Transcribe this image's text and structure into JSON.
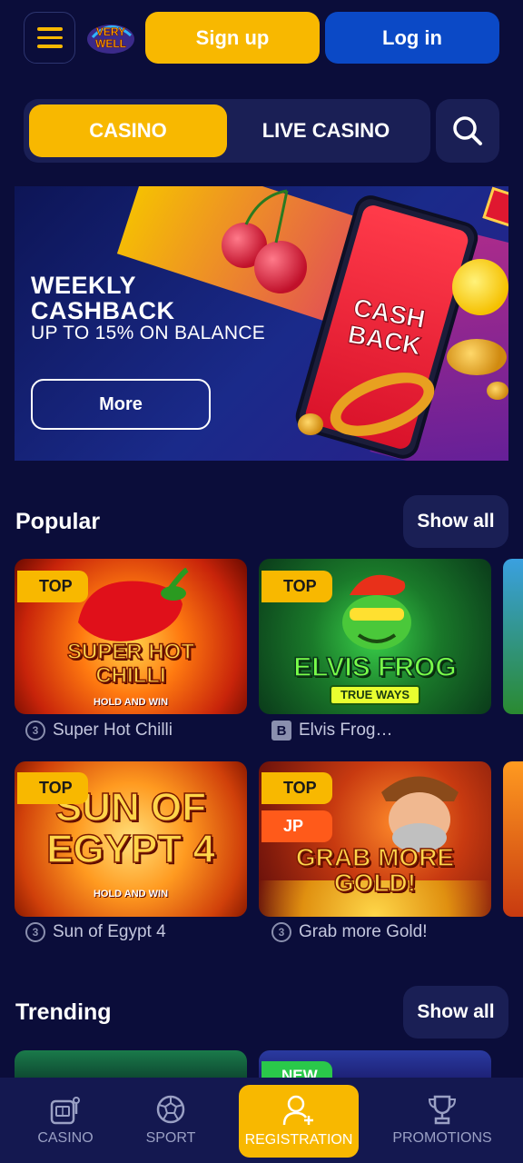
{
  "header": {
    "menu_icon": "hamburger-icon",
    "logo_text": "VERY WELL",
    "signup_label": "Sign up",
    "login_label": "Log in"
  },
  "tabs": [
    {
      "label": "CASINO",
      "active": true
    },
    {
      "label": "LIVE CASINO",
      "active": false
    }
  ],
  "search_icon": "search-icon",
  "banner": {
    "title": "WEEKLY CASHBACK",
    "subtitle": "UP TO 15% ON BALANCE",
    "button_label": "More",
    "phone_text": "CASH BACK"
  },
  "popular": {
    "title": "Popular",
    "show_all_label": "Show all",
    "games": [
      {
        "name": "Super Hot Chilli",
        "art_title": "SUPER HOT CHILLI",
        "art_sub": "HOLD AND WIN",
        "badges": [
          "TOP"
        ],
        "provider_icon": "3"
      },
      {
        "name": "Elvis Frog…",
        "art_title": "ELVIS FROG",
        "art_sub": "TRUE WAYS",
        "badges": [
          "TOP"
        ],
        "provider_icon": "B"
      },
      {
        "name": "Sun of Egypt 4",
        "art_title": "SUN OF EGYPT 4",
        "art_sub": "HOLD AND WIN",
        "badges": [
          "TOP"
        ],
        "provider_icon": "3"
      },
      {
        "name": "Grab more Gold!",
        "art_title": "GRAB MORE GOLD!",
        "art_sub": "",
        "badges": [
          "TOP",
          "JP"
        ],
        "provider_icon": "3"
      }
    ]
  },
  "trending": {
    "title": "Trending",
    "show_all_label": "Show all",
    "badge_peek": "NEW"
  },
  "bottom_nav": [
    {
      "label": "CASINO",
      "icon": "slot-machine-icon",
      "active": false
    },
    {
      "label": "SPORT",
      "icon": "soccer-ball-icon",
      "active": false
    },
    {
      "label": "REGISTRATION",
      "icon": "add-user-icon",
      "active": true
    },
    {
      "label": "PROMOTIONS",
      "icon": "trophy-icon",
      "active": false
    }
  ],
  "colors": {
    "background": "#0b0d3a",
    "accent": "#f8b800",
    "primary_blue": "#0b49c6",
    "surface": "#1a1f55"
  }
}
